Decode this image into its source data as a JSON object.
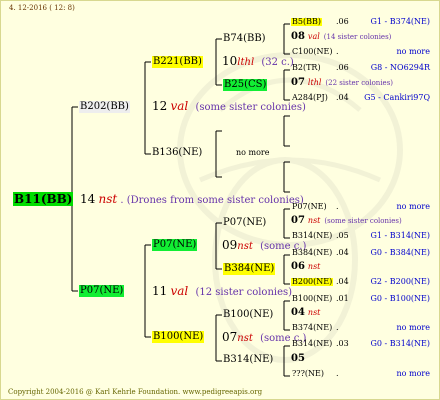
{
  "header": {
    "date": "4. 12-2016 ( 12:  8)"
  },
  "footer": {
    "copyright": "Copyright 2004-2016 @ Karl Kehrle Foundation.   www.pedigreeapis.org"
  },
  "gen1": {
    "code": "B11(BB)"
  },
  "gen2": {
    "sire": {
      "year": "14",
      "mark": "nst",
      "note": ". (Drones from some sister colonies)"
    },
    "upper": {
      "code": "B202(BB)"
    },
    "lower": {
      "code": "P07(NE)"
    }
  },
  "gen3": {
    "upper": {
      "year": "12",
      "mark": "val",
      "note": "(some sister colonies)"
    },
    "lower": {
      "year": "11",
      "mark": "val",
      "note": "(12 sister colonies)"
    },
    "a": {
      "code": "B221(BB)"
    },
    "b": {
      "code": "B136(NE)"
    },
    "c": {
      "code": "P07(NE)"
    },
    "d": {
      "code": "B100(NE)"
    }
  },
  "gen4": {
    "a": {
      "year": "10",
      "mark": "lthl",
      "note": "(32 c.)"
    },
    "b": {
      "note": "no more"
    },
    "c": {
      "year": "09",
      "mark": "nst",
      "note": "(some c.)"
    },
    "d": {
      "year": "07",
      "mark": "nst",
      "note": "(some c.)"
    },
    "n1": {
      "code": "B74(BB)"
    },
    "n2": {
      "code": "B25(CS)"
    },
    "n3": {
      "code": "P07(NE)"
    },
    "n4": {
      "code": "B384(NE)"
    },
    "n5": {
      "code": "B100(NE)"
    },
    "n6": {
      "code": "B314(NE)"
    }
  },
  "gen5": [
    {
      "code": "B5(BB)",
      "c2": ".06",
      "c3": "G1 - B374(NE)"
    },
    {
      "year": "08",
      "mark": "val",
      "note": "(14 sister colonies)"
    },
    {
      "code": "C100(NE)",
      "c2": ".",
      "c3": "no more"
    },
    {
      "code": "B2(TR)",
      "c2": ".06",
      "c3": "G8 - NO6294R"
    },
    {
      "year": "07",
      "mark": "lthl",
      "note": "(22 sister colonies)"
    },
    {
      "code": "A284(PJ)",
      "c2": ".04",
      "c3": "G5 - Cankiri97Q"
    },
    {
      "code": "P07(NE)",
      "c2": ".",
      "c3": "no more"
    },
    {
      "year": "07",
      "mark": "nst",
      "note": "(some sister colonies)"
    },
    {
      "code": "B314(NE)",
      "c2": ".05",
      "c3": "G1 - B314(NE)"
    },
    {
      "code": "B384(NE)",
      "c2": ".04",
      "c3": "G0 - B384(NE)"
    },
    {
      "year": "06",
      "mark": "nst",
      "note": ""
    },
    {
      "code": "B200(NE)",
      "c2": ".04",
      "c3": "G2 - B200(NE)"
    },
    {
      "code": "B100(NE)",
      "c2": ".01",
      "c3": "G0 - B100(NE)"
    },
    {
      "year": "04",
      "mark": "nst",
      "note": ""
    },
    {
      "code": "B374(NE)",
      "c2": ".",
      "c3": "no more"
    },
    {
      "code": "B314(NE)",
      "c2": ".03",
      "c3": "G0 - B314(NE)"
    },
    {
      "year": "05",
      "mark": "",
      "note": ""
    },
    {
      "code": "???(NE)",
      "c2": ".",
      "c3": "no more"
    }
  ]
}
